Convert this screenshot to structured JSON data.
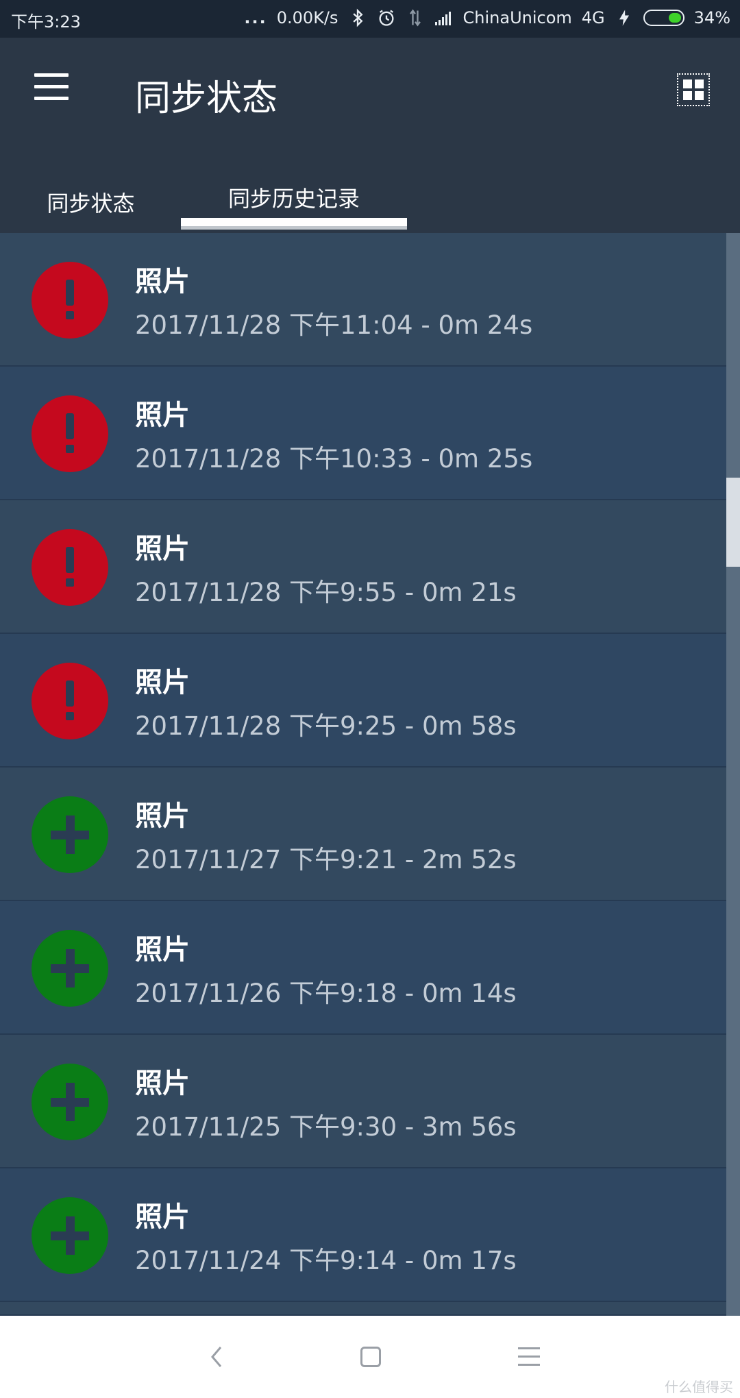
{
  "status_bar": {
    "time": "下午3:23",
    "dots": "...",
    "speed": "0.00K/s",
    "carrier": "ChinaUnicom",
    "network": "4G",
    "battery": "34%",
    "battery_level": 0.34
  },
  "app_bar": {
    "title": "同步状态",
    "icons": [
      "menu-icon",
      "grid-icon"
    ]
  },
  "tabs": [
    {
      "label": "同步状态",
      "selected": false
    },
    {
      "label": "同步历史记录",
      "selected": true
    }
  ],
  "history": [
    {
      "title": "照片",
      "subtitle": "2017/11/28 下午11:04 - 0m 24s",
      "status": "error"
    },
    {
      "title": "照片",
      "subtitle": "2017/11/28 下午10:33 - 0m 25s",
      "status": "error"
    },
    {
      "title": "照片",
      "subtitle": "2017/11/28 下午9:55 - 0m 21s",
      "status": "error"
    },
    {
      "title": "照片",
      "subtitle": "2017/11/28 下午9:25 - 0m 58s",
      "status": "error"
    },
    {
      "title": "照片",
      "subtitle": "2017/11/27 下午9:21 - 2m 52s",
      "status": "success"
    },
    {
      "title": "照片",
      "subtitle": "2017/11/26 下午9:18 - 0m 14s",
      "status": "success"
    },
    {
      "title": "照片",
      "subtitle": "2017/11/25 下午9:30 - 3m 56s",
      "status": "success"
    },
    {
      "title": "照片",
      "subtitle": "2017/11/24 下午9:14 - 0m 17s",
      "status": "success"
    }
  ],
  "colors": {
    "error": "#c5091e",
    "success": "#0a7d16",
    "app_bar": "#2b3746",
    "list_bg": "#2f4762"
  },
  "nav_bar": {
    "icons": [
      "back-icon",
      "home-icon",
      "recents-icon"
    ]
  },
  "watermark": "什么值得买"
}
